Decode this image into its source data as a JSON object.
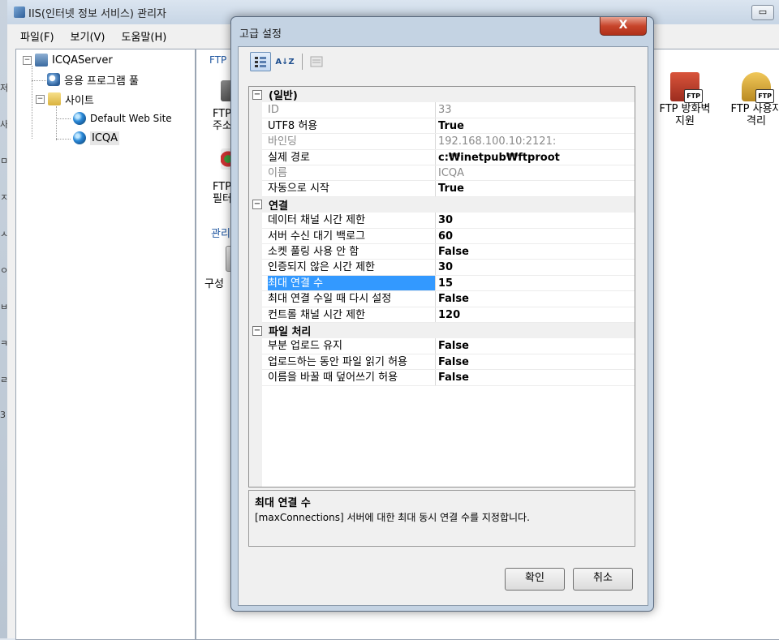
{
  "iis": {
    "title": "IIS(인터넷 정보 서비스) 관리자",
    "menu": [
      "파일(F)",
      "보기(V)",
      "도움말(H)"
    ],
    "tree": {
      "server": "ICQAServer",
      "app_pool": "응용 프로그램 풀",
      "sites": "사이트",
      "default_site": "Default Web Site",
      "icqa": "ICQA"
    },
    "content": {
      "header": "FTP",
      "features": [
        {
          "line1": "FTP 방화벽",
          "line2": "지원"
        },
        {
          "line1": "FTP 사용자",
          "line2": "격리"
        }
      ],
      "partial": [
        {
          "line1": "FTP",
          "line2": "주소"
        },
        {
          "line1": "FTP",
          "line2": "필터"
        }
      ],
      "manage_label": "관리",
      "config_label": "구성"
    },
    "left_strip_marks": [
      "저",
      "사",
      "ㅁ",
      "ㅈ",
      "ㅅ",
      "ㅇ",
      "ㅂ",
      "ㅋ",
      "ㄹ",
      "3"
    ]
  },
  "dialog": {
    "title": "고급 설정",
    "close_label": "X",
    "toolbar": {
      "sort_alpha_label": "A↓Z"
    },
    "categories": [
      {
        "name": "(일반)",
        "props": [
          {
            "name": "ID",
            "value": "33",
            "readonly": true
          },
          {
            "name": "UTF8 허용",
            "value": "True",
            "readonly": false
          },
          {
            "name": "바인딩",
            "value": "192.168.100.10:2121:",
            "readonly": true
          },
          {
            "name": "실제 경로",
            "value": "c:₩inetpub₩ftproot",
            "readonly": false
          },
          {
            "name": "이름",
            "value": "ICQA",
            "readonly": true
          },
          {
            "name": "자동으로 시작",
            "value": "True",
            "readonly": false
          }
        ]
      },
      {
        "name": "연결",
        "props": [
          {
            "name": "데이터 채널 시간 제한",
            "value": "30",
            "readonly": false
          },
          {
            "name": "서버 수신 대기 백로그",
            "value": "60",
            "readonly": false
          },
          {
            "name": "소켓 풀링 사용 안 함",
            "value": "False",
            "readonly": false
          },
          {
            "name": "인증되지 않은 시간 제한",
            "value": "30",
            "readonly": false
          },
          {
            "name": "최대 연결 수",
            "value": "15",
            "readonly": false,
            "selected": true
          },
          {
            "name": "최대 연결 수일 때 다시 설정",
            "value": "False",
            "readonly": false
          },
          {
            "name": "컨트롤 채널 시간 제한",
            "value": "120",
            "readonly": false
          }
        ]
      },
      {
        "name": "파일 처리",
        "props": [
          {
            "name": "부분 업로드 유지",
            "value": "False",
            "readonly": false
          },
          {
            "name": "업로드하는 동안 파일 읽기 허용",
            "value": "False",
            "readonly": false
          },
          {
            "name": "이름을 바꿀 때 덮어쓰기 허용",
            "value": "False",
            "readonly": false
          }
        ]
      }
    ],
    "description": {
      "title": "최대 연결 수",
      "text": "[maxConnections] 서버에 대한 최대 동시 연결 수를 지정합니다."
    },
    "buttons": {
      "ok": "확인",
      "cancel": "취소"
    }
  }
}
